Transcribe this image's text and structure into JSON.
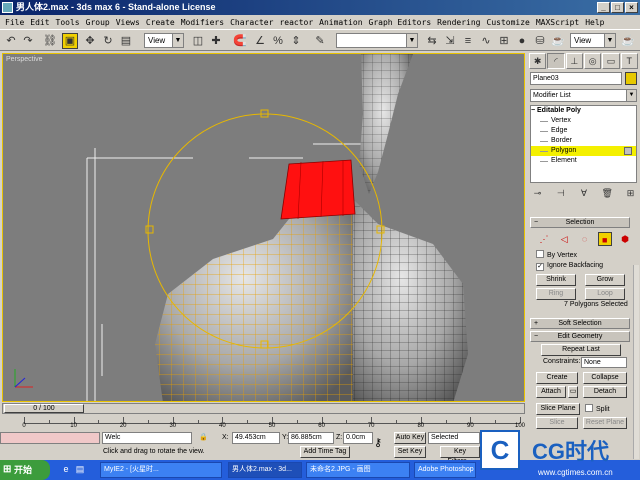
{
  "window": {
    "title": "男人体2.max - 3ds max 6 - Stand-alone License"
  },
  "menu": [
    "File",
    "Edit",
    "Tools",
    "Group",
    "Views",
    "Create",
    "Modifiers",
    "Character",
    "reactor",
    "Animation",
    "Graph Editors",
    "Rendering",
    "Customize",
    "MAXScript",
    "Help"
  ],
  "toolbar": {
    "view_dropdown_1": "View",
    "view_dropdown_2": "View"
  },
  "viewport": {
    "label": "Perspective"
  },
  "command_panel": {
    "object_name": "Plane03",
    "modifier_list": "Modifier List",
    "stack": {
      "root": "Editable Poly",
      "items": [
        "Vertex",
        "Edge",
        "Border",
        "Polygon",
        "Element"
      ],
      "selected": "Polygon"
    },
    "selection": {
      "title": "Selection",
      "by_vertex": "By Vertex",
      "ignore_backfacing": "Ignore Backfacing",
      "shrink": "Shrink",
      "grow": "Grow",
      "ring": "Ring",
      "loop": "Loop",
      "info": "7 Polygons Selected"
    },
    "soft_selection": {
      "title": "Soft Selection"
    },
    "edit_geometry": {
      "title": "Edit Geometry",
      "repeat_last": "Repeat Last",
      "constraints_label": "Constraints:",
      "constraints_value": "None",
      "create": "Create",
      "collapse": "Collapse",
      "attach": "Attach",
      "detach": "Detach",
      "slice_plane": "Slice Plane",
      "split": "Split",
      "slice": "Slice",
      "reset_plane": "Reset Plane"
    }
  },
  "timeline": {
    "slider": "0 / 100",
    "ticks": [
      0,
      10,
      20,
      30,
      40,
      50,
      60,
      70,
      80,
      90,
      100
    ]
  },
  "status": {
    "x_label": "X:",
    "x_value": "49.453cm",
    "y_label": "Y:",
    "y_value": "86.885cm",
    "z_label": "Z:",
    "z_value": "0.0cm",
    "prompt": "Click and drag to rotate the view.",
    "add_time_tag": "Add Time Tag",
    "auto_key": "Auto Key",
    "selected": "Selected",
    "set_key": "Set Key",
    "key_filters": "Key Filters...",
    "maxscript_hint": "Welc"
  },
  "taskbar": {
    "start": "开始",
    "tasks": [
      "MyIE2 - [火星时...",
      "男人体2.max - 3d...",
      "未命名2.JPG - 画图",
      "Adobe Photoshop"
    ]
  },
  "watermark": {
    "logo": "C",
    "text": "CG时代",
    "url": "www.cgtimes.com.cn"
  }
}
